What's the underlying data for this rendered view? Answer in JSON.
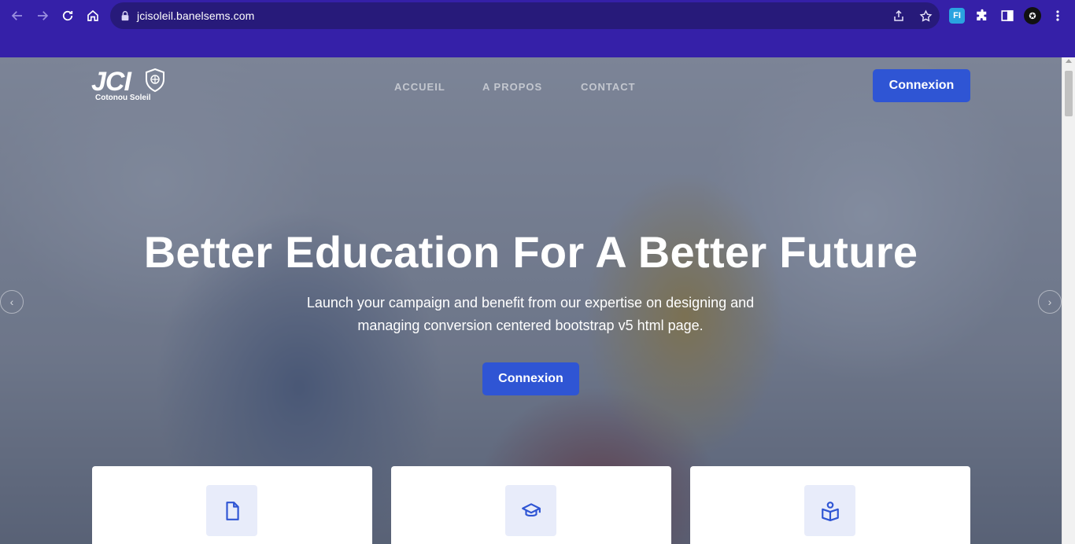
{
  "browser": {
    "url": "jcisoleil.banelsems.com",
    "extension_badge": "FI"
  },
  "site": {
    "logo_text": "JCI",
    "logo_subtitle": "Cotonou Soleil",
    "nav": [
      {
        "label": "ACCUEIL"
      },
      {
        "label": "A PROPOS"
      },
      {
        "label": "CONTACT"
      }
    ],
    "header_button": "Connexion"
  },
  "hero": {
    "title": "Better Education For A Better Future",
    "subtitle": "Launch your campaign and benefit from our expertise on designing and managing conversion centered bootstrap v5 html page.",
    "button": "Connexion",
    "prev_arrow": "‹",
    "next_arrow": "›"
  },
  "features": [
    {
      "icon": "document-icon"
    },
    {
      "icon": "graduation-cap-icon"
    },
    {
      "icon": "book-reader-icon"
    }
  ],
  "colors": {
    "browser_frame": "#3520a8",
    "primary": "#2f55d4",
    "icon_box": "#e8ecfa"
  }
}
